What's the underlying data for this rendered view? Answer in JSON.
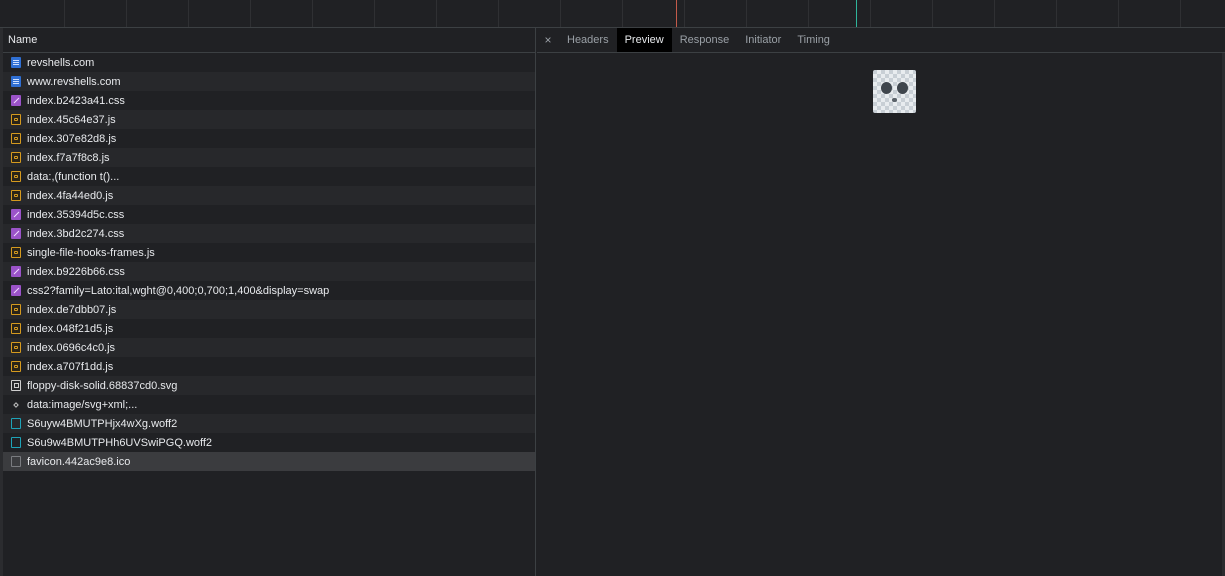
{
  "list": {
    "header": "Name",
    "items": [
      {
        "name": "revshells.com",
        "type": "doc"
      },
      {
        "name": "www.revshells.com",
        "type": "doc"
      },
      {
        "name": "index.b2423a41.css",
        "type": "css"
      },
      {
        "name": "index.45c64e37.js",
        "type": "js"
      },
      {
        "name": "index.307e82d8.js",
        "type": "js"
      },
      {
        "name": "index.f7a7f8c8.js",
        "type": "js"
      },
      {
        "name": "data:,(function t()...",
        "type": "js"
      },
      {
        "name": "index.4fa44ed0.js",
        "type": "js"
      },
      {
        "name": "index.35394d5c.css",
        "type": "css"
      },
      {
        "name": "index.3bd2c274.css",
        "type": "css"
      },
      {
        "name": "single-file-hooks-frames.js",
        "type": "js"
      },
      {
        "name": "index.b9226b66.css",
        "type": "css"
      },
      {
        "name": "css2?family=Lato:ital,wght@0,400;0,700;1,400&display=swap",
        "type": "css"
      },
      {
        "name": "index.de7dbb07.js",
        "type": "js"
      },
      {
        "name": "index.048f21d5.js",
        "type": "js"
      },
      {
        "name": "index.0696c4c0.js",
        "type": "js"
      },
      {
        "name": "index.a707f1dd.js",
        "type": "js"
      },
      {
        "name": "floppy-disk-solid.68837cd0.svg",
        "type": "svg"
      },
      {
        "name": "data:image/svg+xml;...",
        "type": "data"
      },
      {
        "name": "S6uyw4BMUTPHjx4wXg.woff2",
        "type": "font"
      },
      {
        "name": "S6u9w4BMUTPHh6UVSwiPGQ.woff2",
        "type": "font"
      },
      {
        "name": "favicon.442ac9e8.ico",
        "type": "ico"
      }
    ],
    "selected_index": 21
  },
  "tabs": {
    "close_glyph": "×",
    "items": [
      "Headers",
      "Preview",
      "Response",
      "Initiator",
      "Timing"
    ],
    "active_index": 1
  },
  "preview": {
    "image": "favicon-ghost-image"
  },
  "colors": {
    "background": "#202124",
    "doc_icon": "#2f6fd3",
    "css_icon": "#9b53c9",
    "js_icon": "#d59a1f",
    "font_icon": "#1ea3b8",
    "timeline_red": "#c35a4a",
    "timeline_green": "#2fb59b"
  }
}
